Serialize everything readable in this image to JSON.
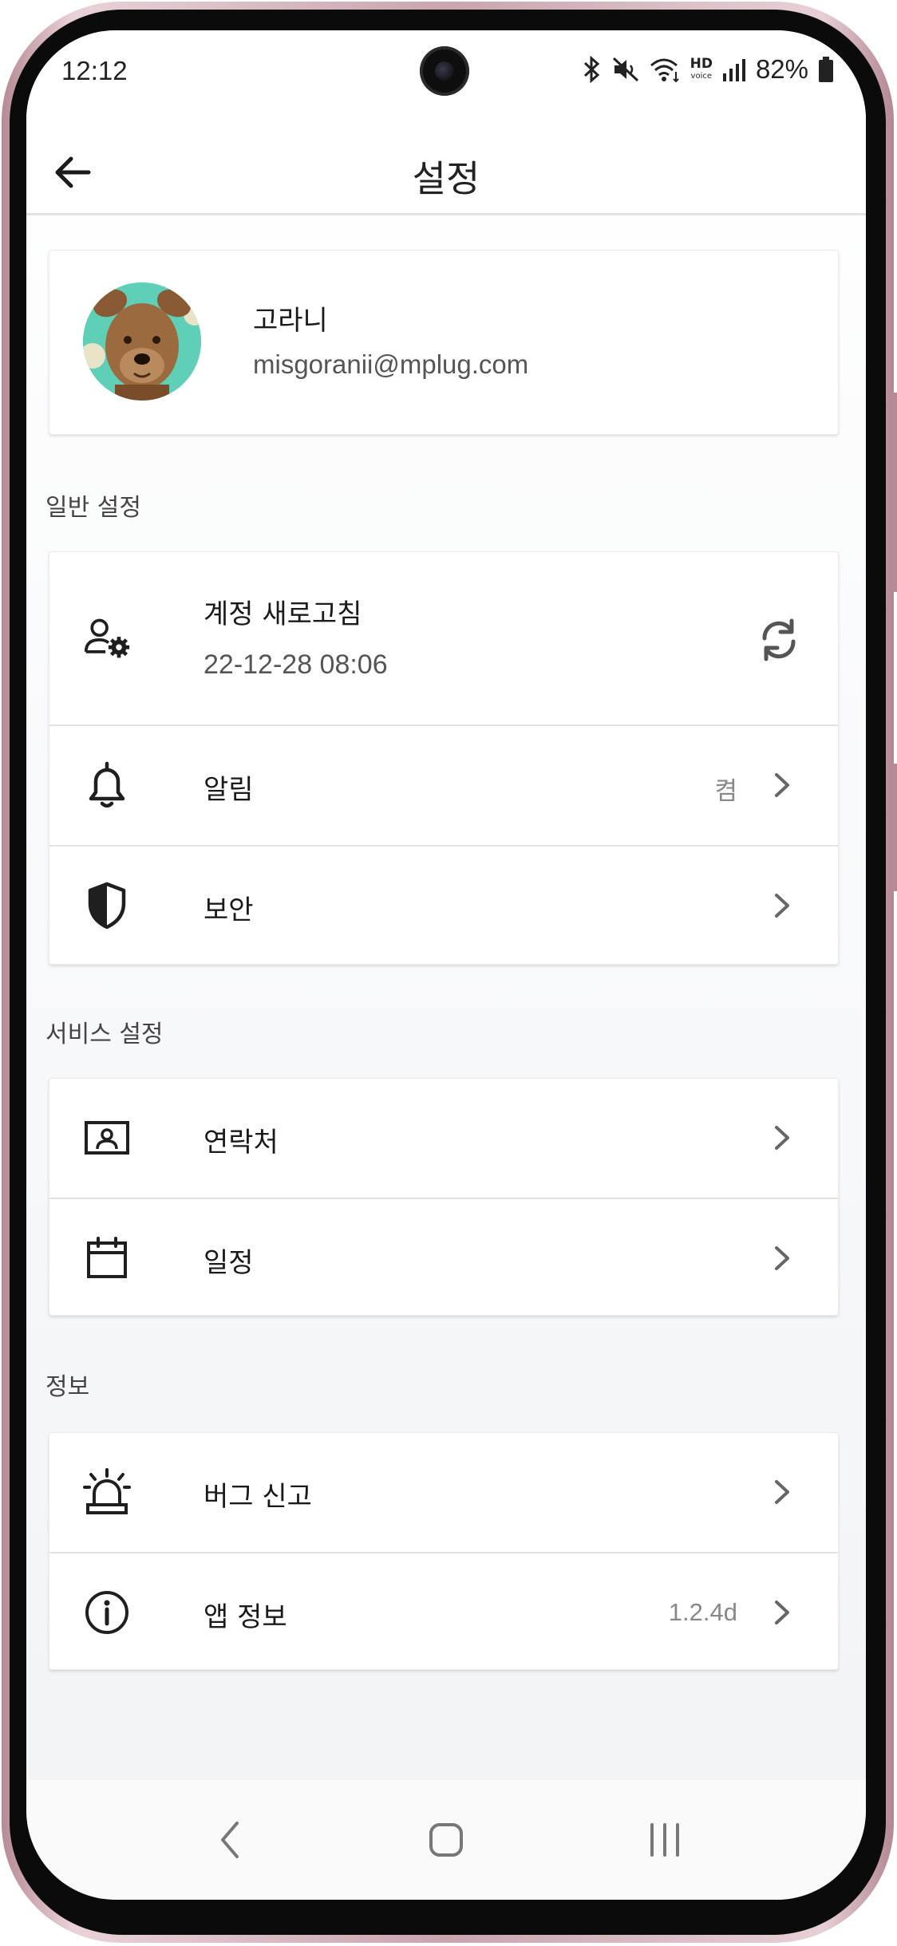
{
  "status_bar": {
    "time": "12:12",
    "hd_label": "HD",
    "voice_label": "voice",
    "battery": "82%"
  },
  "app_bar": {
    "title": "설정"
  },
  "profile": {
    "name": "고라니",
    "email": "misgoranii@mplug.com"
  },
  "general_settings": {
    "label": "일반 설정",
    "items": [
      {
        "label": "계정 새로고침",
        "sublabel": "22-12-28 08:06",
        "icon": "account-gear-icon",
        "trailing_icon": "refresh-icon"
      },
      {
        "label": "알림",
        "value": "켬",
        "icon": "bell-icon"
      },
      {
        "label": "보안",
        "icon": "shield-icon"
      }
    ]
  },
  "service_settings": {
    "label": "서비스 설정",
    "items": [
      {
        "label": "연락처",
        "icon": "contact-card-icon"
      },
      {
        "label": "일정",
        "icon": "calendar-icon"
      }
    ]
  },
  "info": {
    "label": "정보",
    "items": [
      {
        "label": "버그 신고",
        "icon": "siren-icon"
      },
      {
        "label": "앱 정보",
        "value": "1.2.4d",
        "icon": "info-icon"
      }
    ]
  },
  "colors": {
    "accent_avatar_bg": "#5fd0b7",
    "text_primary": "#1a1a1a",
    "text_secondary": "#888888"
  }
}
